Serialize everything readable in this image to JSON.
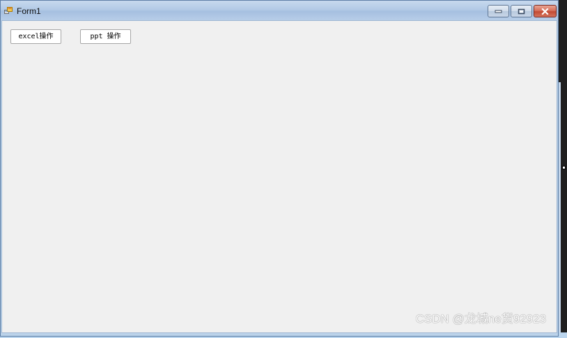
{
  "window": {
    "title": "Form1",
    "icon": "winforms-app-icon"
  },
  "caption": {
    "minimize_icon": "minimize-icon",
    "maximize_icon": "maximize-icon",
    "close_icon": "close-icon"
  },
  "buttons": {
    "excel_label": "excel操作",
    "ppt_label": "ppt 操作"
  },
  "watermark": {
    "text": "CSDN @龙城ne货92923"
  },
  "colors": {
    "client_bg": "#f0f0f0",
    "titlebar": "#b3cae6",
    "close_red": "#c24a33"
  }
}
